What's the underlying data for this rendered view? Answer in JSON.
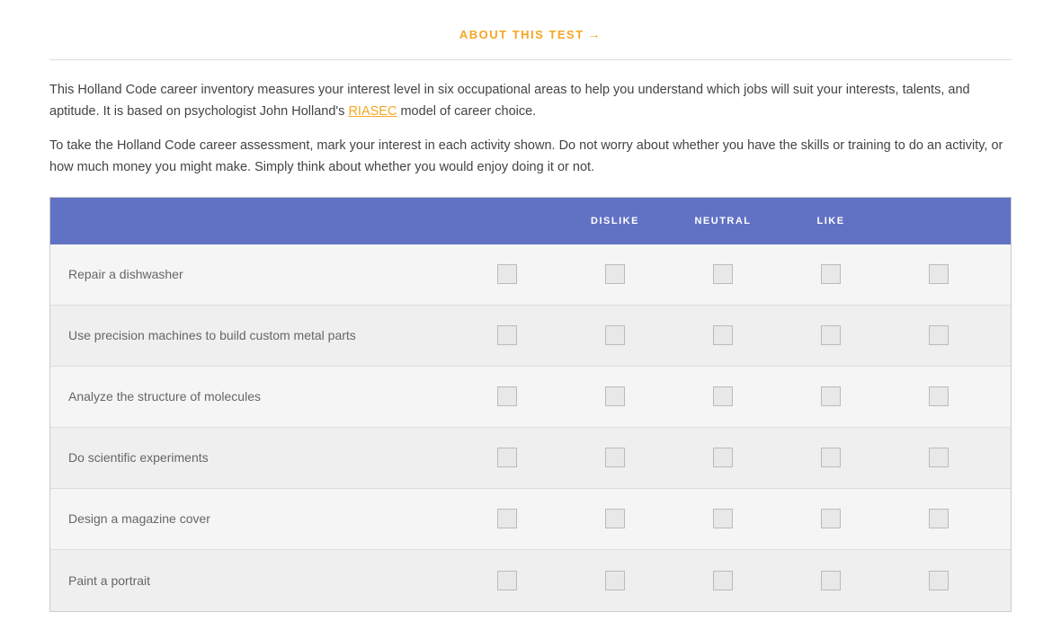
{
  "header": {
    "about_link": "ABOUT THIS TEST",
    "arrow": "→"
  },
  "intro": {
    "paragraph1": "This Holland Code career inventory measures your interest level in six occupational areas to help you understand which jobs will suit your interests, talents, and aptitude. It is based on psychologist John Holland's ",
    "riasec_text": "RIASEC",
    "paragraph1_end": " model of career choice.",
    "paragraph2": "To take the Holland Code career assessment, mark your interest in each activity shown. Do not worry about whether you have the skills or training to do an activity, or how much money you might make. Simply think about whether you would enjoy doing it or not."
  },
  "table": {
    "columns": {
      "activity": "",
      "dislike": "DISLIKE",
      "neutral": "NEUTRAL",
      "like": "LIKE"
    },
    "activities": [
      "Repair a dishwasher",
      "Use precision machines to build custom metal parts",
      "Analyze the structure of molecules",
      "Do scientific experiments",
      "Design a magazine cover",
      "Paint a portrait"
    ]
  }
}
